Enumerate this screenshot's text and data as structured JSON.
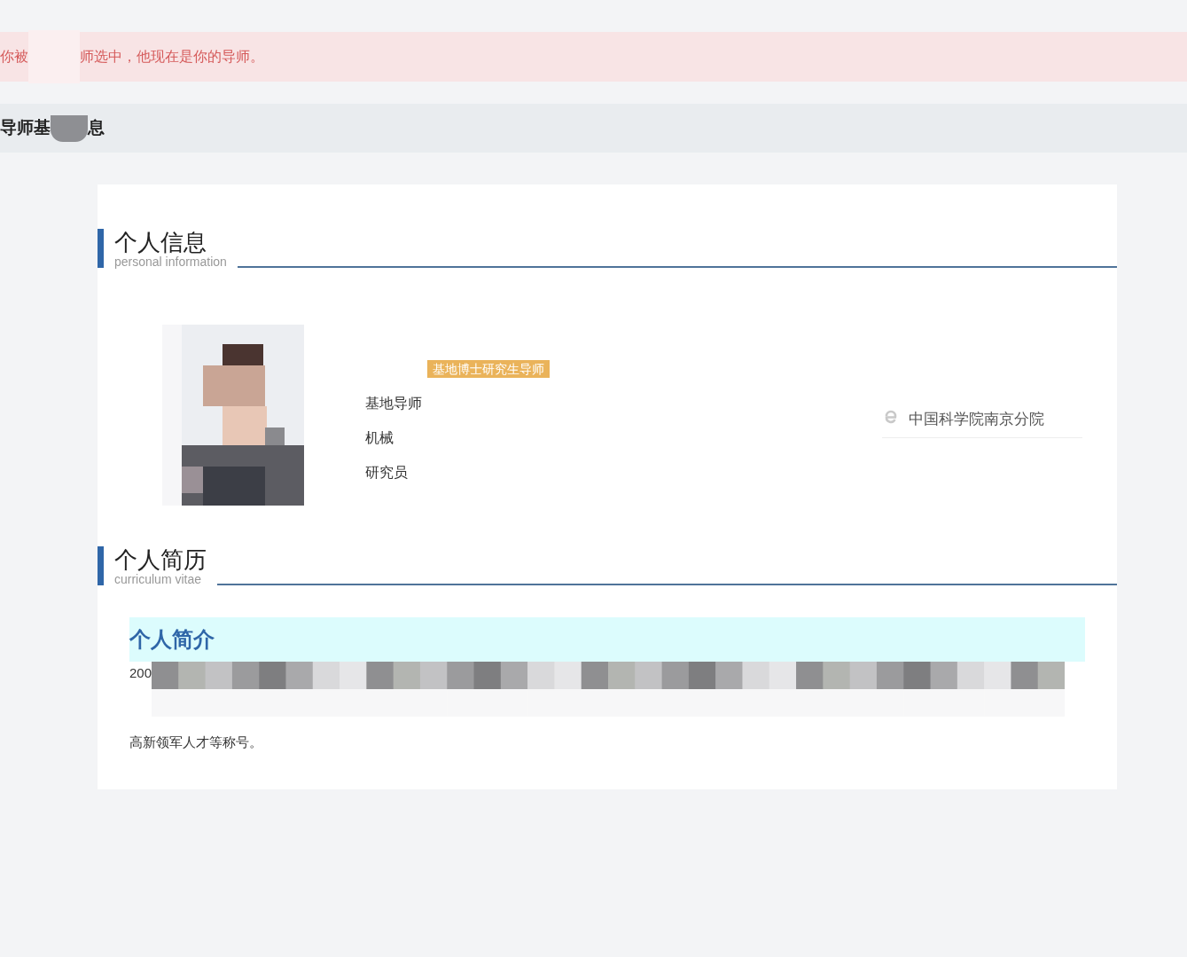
{
  "alert": {
    "text_before": "你被",
    "text_after": "师选中，他现在是你的导师。"
  },
  "page_header": {
    "text_before": "导师基",
    "text_after": "息"
  },
  "personal_info": {
    "title": "个人信息",
    "subtitle": "personal information",
    "tag": "基地博士研究生导师",
    "fields": [
      "基地导师",
      "机械",
      "研究员"
    ],
    "affiliation": "中国科学院南京分院"
  },
  "cv": {
    "title": "个人简历",
    "subtitle": "curriculum vitae",
    "intro_heading": "个人简介",
    "intro_start": "200",
    "intro_end": "高新领军人才等称号。"
  }
}
